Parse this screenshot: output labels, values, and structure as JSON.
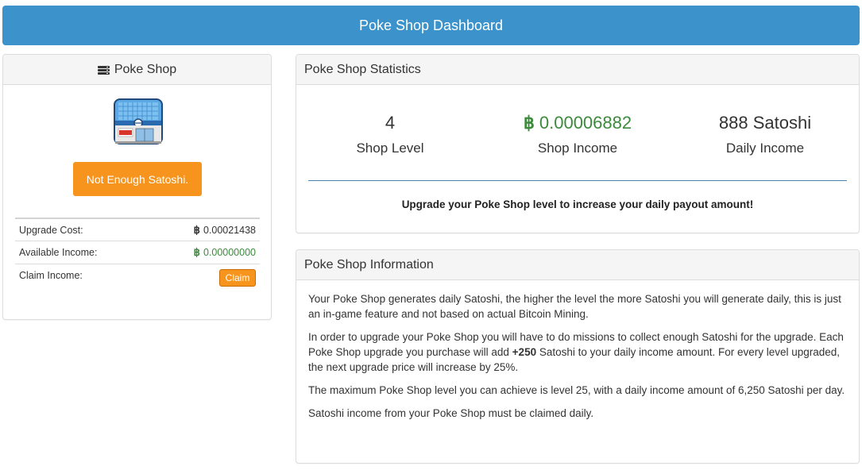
{
  "header": {
    "title": "Poke Shop Dashboard"
  },
  "shop_panel": {
    "title": "Poke Shop",
    "icon": "server-icon",
    "image_icon": "poke-shop-building",
    "status_button": "Not Enough Satoshi.",
    "rows": [
      {
        "label": "Upgrade Cost:",
        "symbol": "฿",
        "value": "0.00021438"
      },
      {
        "label": "Available Income:",
        "symbol": "฿",
        "value": "0.00000000"
      },
      {
        "label": "Claim Income:",
        "button": "Claim"
      }
    ]
  },
  "stats_panel": {
    "title": "Poke Shop Statistics",
    "stats": [
      {
        "value": "4",
        "label": "Shop Level"
      },
      {
        "symbol": "฿",
        "value": "0.00006882",
        "label": "Shop Income"
      },
      {
        "value": "888 Satoshi",
        "label": "Daily Income"
      }
    ],
    "note": "Upgrade your Poke Shop level to increase your daily payout amount!"
  },
  "info_panel": {
    "title": "Poke Shop Information",
    "p1": "Your Poke Shop generates daily Satoshi, the higher the level the more Satoshi you will generate daily, this is just an in-game feature and not based on actual Bitcoin Mining.",
    "p2_a": "In order to upgrade your Poke Shop you will have to do missions to collect enough Satoshi for the upgrade. Each Poke Shop upgrade you purchase will add ",
    "p2_bold": "+250",
    "p2_b": " Satoshi to your daily income amount. For every level upgraded, the next upgrade price will increase by 25%.",
    "p3": "The maximum Poke Shop level you can achieve is level 25, with a daily income amount of 6,250 Satoshi per day.",
    "p4": "Satoshi income from your Poke Shop must be claimed daily."
  },
  "colors": {
    "header_bg": "#3c93cc",
    "orange": "#f7941d",
    "green": "#3c8a3c",
    "divider": "#4a82b0"
  }
}
